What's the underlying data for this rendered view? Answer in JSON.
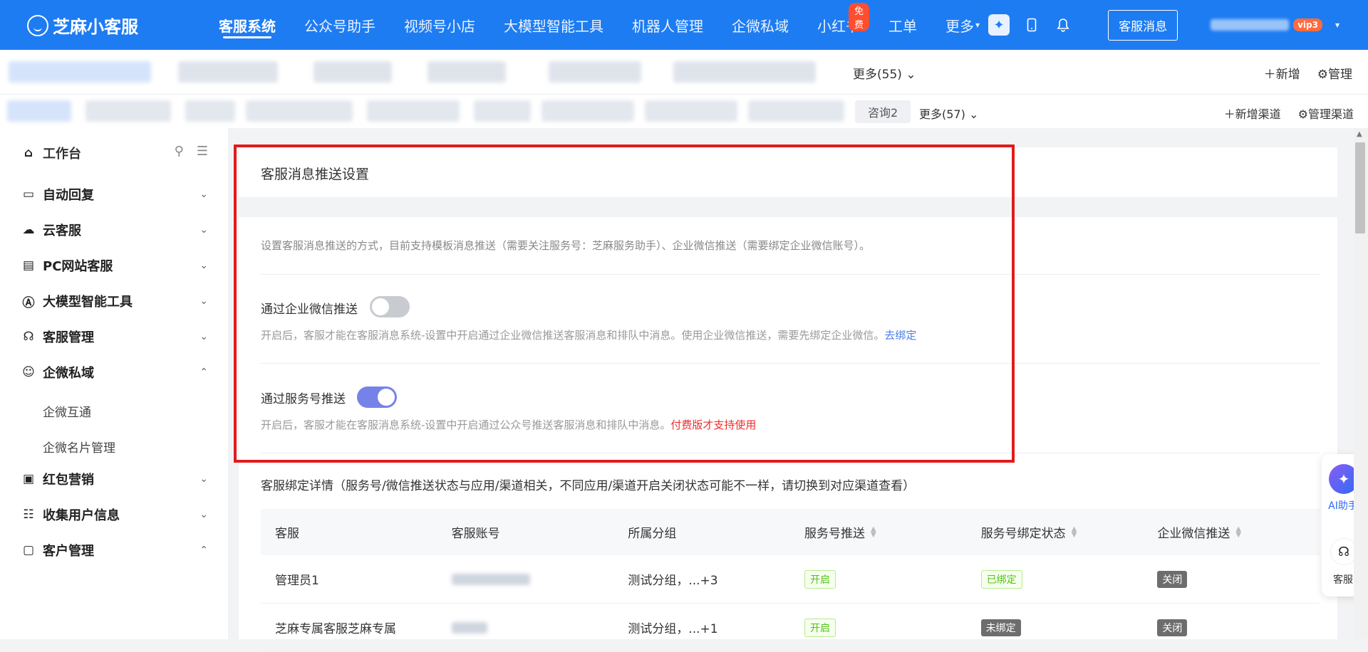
{
  "brand": {
    "name": "芝麻小客服"
  },
  "nav": {
    "items": [
      "客服系统",
      "公众号助手",
      "视频号小店",
      "大模型智能工具",
      "机器人管理",
      "企微私域",
      "小红书",
      "工单",
      "更多"
    ],
    "free_badge": "免费",
    "msg_button": "客服消息",
    "vip": "vip3"
  },
  "appbar": {
    "more": "更多(55)",
    "add": "新增",
    "manage": "管理"
  },
  "chanbar": {
    "tab": "咨询2",
    "more": "更多(57)",
    "add": "新增渠道",
    "manage": "管理渠道"
  },
  "sidebar": {
    "workbench": "工作台",
    "items": [
      "自动回复",
      "云客服",
      "PC网站客服",
      "大模型智能工具",
      "客服管理",
      "企微私域"
    ],
    "subitems": [
      "企微互通",
      "企微名片管理"
    ],
    "items2": [
      "红包营销",
      "收集用户信息",
      "客户管理"
    ]
  },
  "settings": {
    "title": "客服消息推送设置",
    "description": "设置客服消息推送的方式，目前支持模板消息推送（需要关注服务号：芝麻服务助手）、企业微信推送（需要绑定企业微信账号）。",
    "wecom_label": "通过企业微信推送",
    "wecom_enabled": false,
    "wecom_help": "开启后，客服才能在客服消息系统-设置中开启通过企业微信推送客服消息和排队中消息。使用企业微信推送，需要先绑定企业微信。",
    "wecom_link": "去绑定",
    "mp_label": "通过服务号推送",
    "mp_enabled": true,
    "mp_help": "开启后，客服才能在客服消息系统-设置中开启通过公众号推送客服消息和排队中消息。",
    "mp_paid": "付费版才支持使用"
  },
  "binding": {
    "title": "客服绑定详情（服务号/微信推送状态与应用/渠道相关，不同应用/渠道开启关闭状态可能不一样，请切换到对应渠道查看）",
    "columns": [
      "客服",
      "客服账号",
      "所属分组",
      "服务号推送",
      "服务号绑定状态",
      "企业微信推送"
    ],
    "rows": [
      {
        "name": "管理员1",
        "group": "测试分组，...+3",
        "mp_push": "开启",
        "mp_bind": "已绑定",
        "wecom_push": "关闭"
      },
      {
        "name": "芝麻专属客服芝麻专属",
        "group": "测试分组，...+1",
        "mp_push": "开启",
        "mp_bind": "未绑定",
        "wecom_push": "关闭"
      }
    ]
  },
  "float": {
    "ai": "AI助手",
    "service": "客服"
  }
}
